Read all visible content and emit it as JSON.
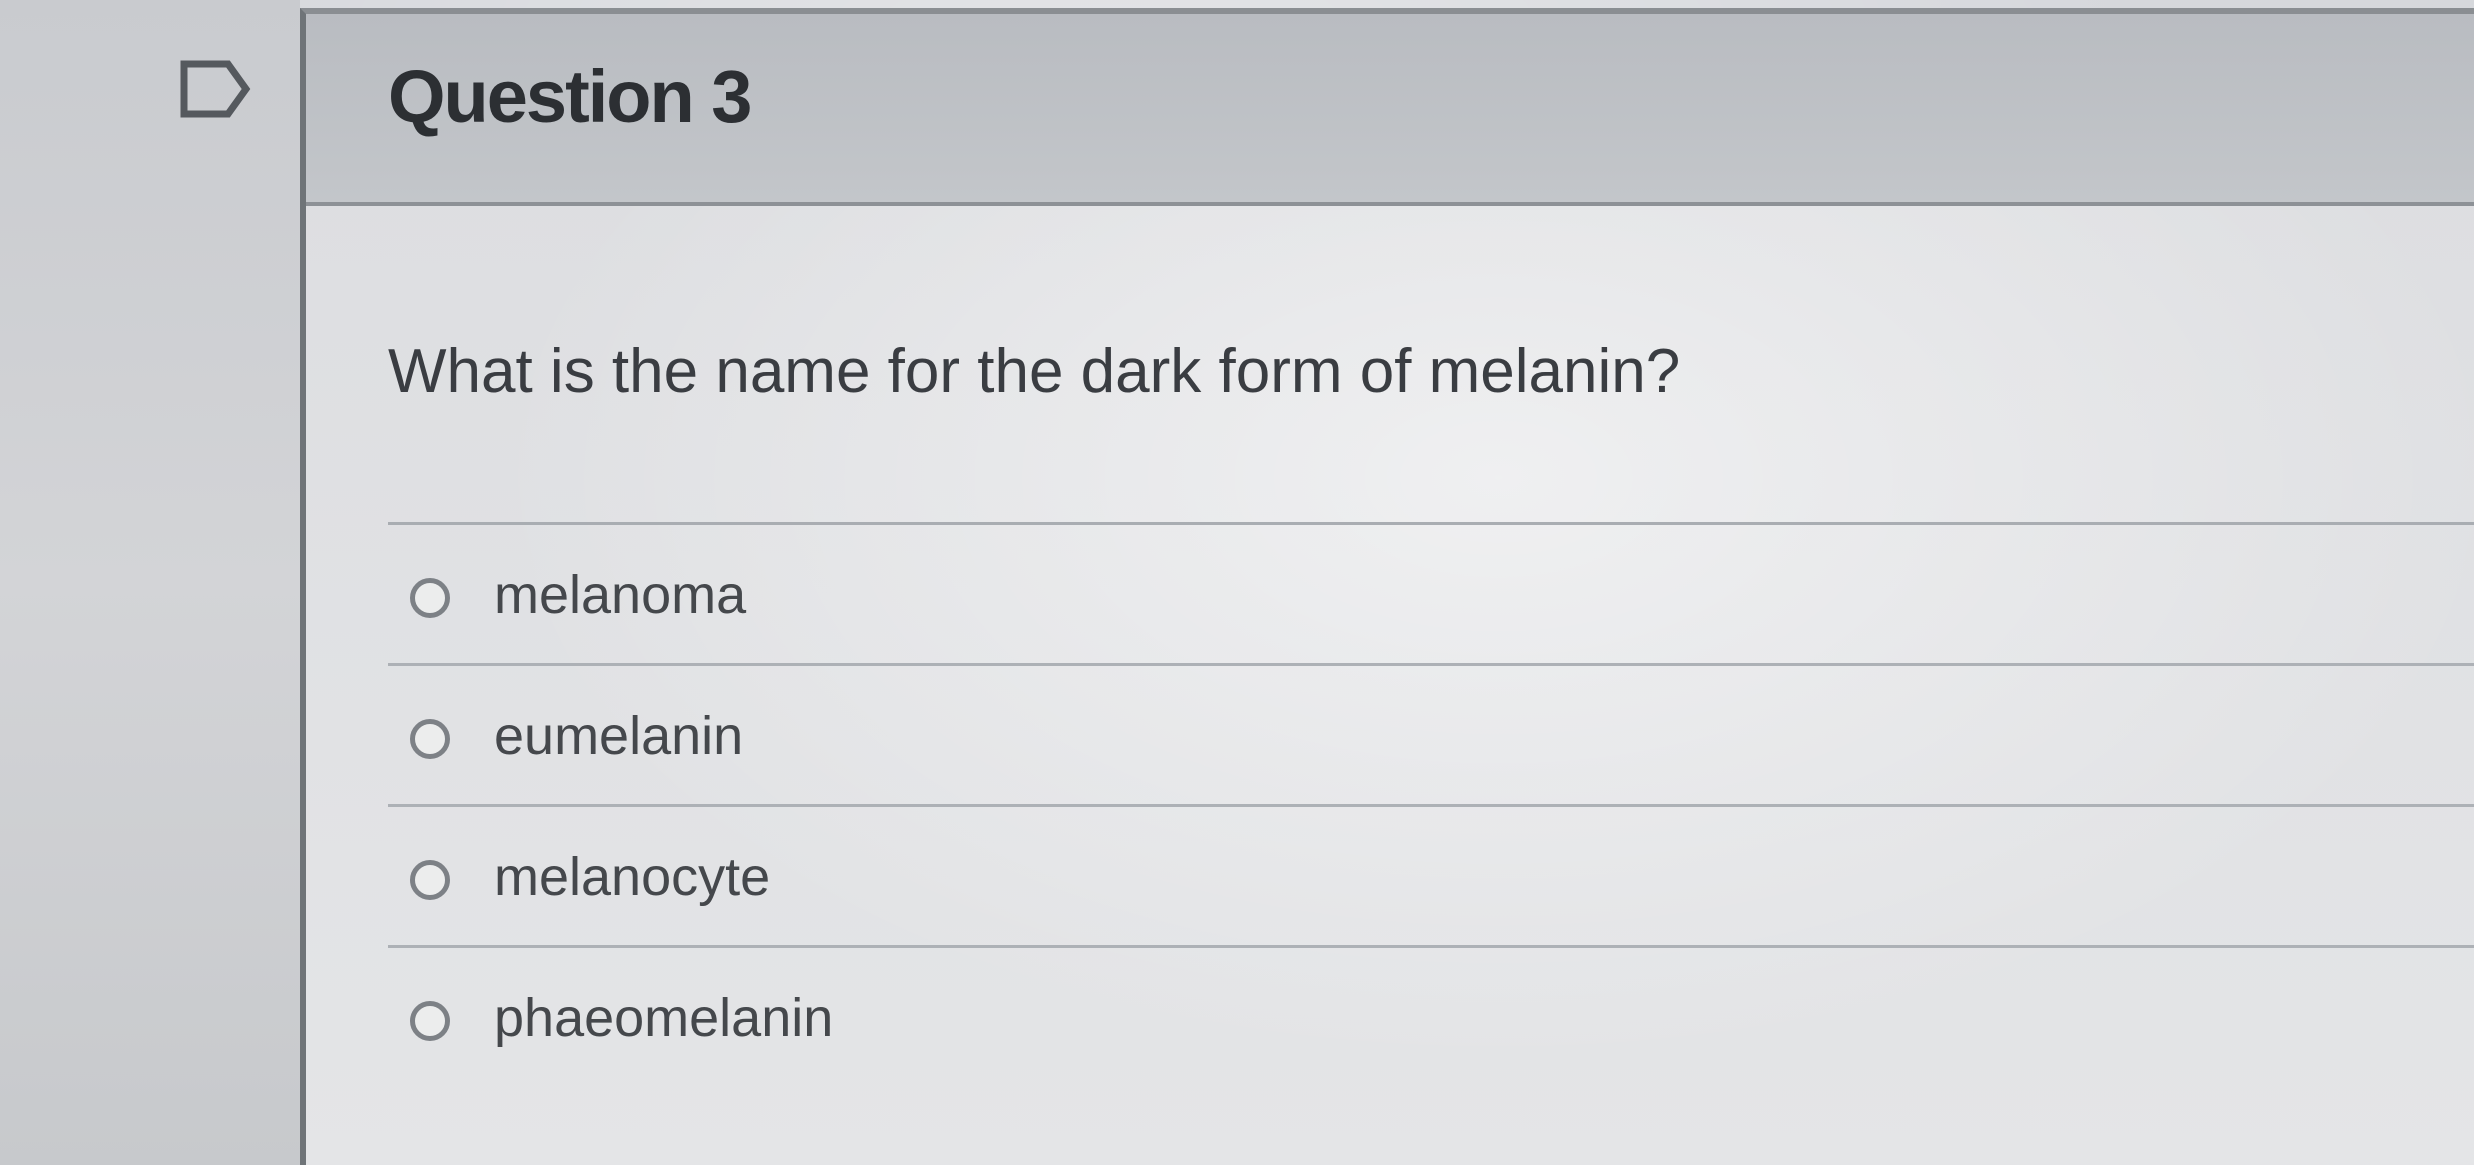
{
  "question": {
    "title": "Question 3",
    "text": "What is the name for the dark form of melanin?"
  },
  "answers": [
    {
      "label": "melanoma",
      "selected": false
    },
    {
      "label": "eumelanin",
      "selected": false
    },
    {
      "label": "melanocyte",
      "selected": false
    },
    {
      "label": "phaeomelanin",
      "selected": false
    }
  ],
  "icons": {
    "flag": "flag-question-icon"
  },
  "colors": {
    "header_bg": "#c0c3c7",
    "text": "#3a3d42",
    "radio_border": "#7d8186"
  }
}
